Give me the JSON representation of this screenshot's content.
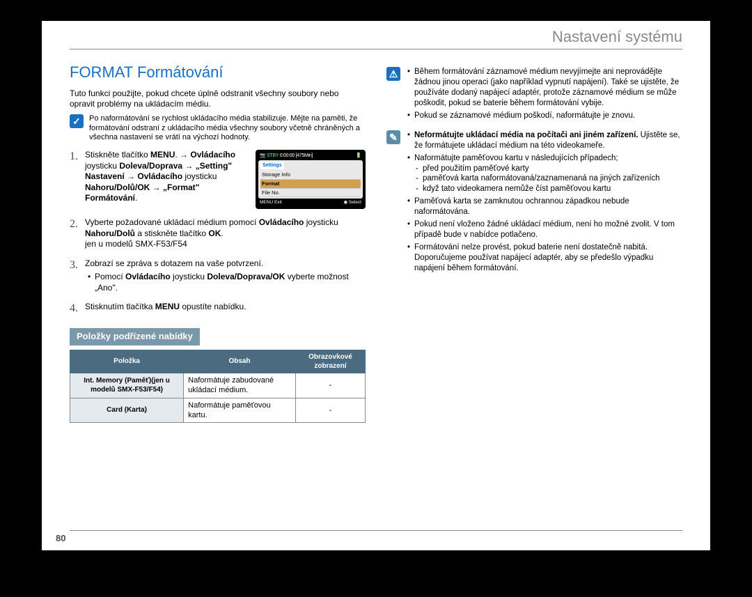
{
  "header": {
    "title": "Nastavení systému"
  },
  "page_number": "80",
  "left": {
    "section_title": "FORMAT Formátování",
    "intro": "Tuto funkci použijte, pokud chcete úplně odstranit všechny soubory nebo opravit problémy na ukládacím médiu.",
    "note1": "Po naformátování se rychlost ukládacího média stabilizuje. Mějte na paměti, že formátování odstraní z ukládacího média všechny soubory včetně chráněných a všechna nastavení se vrátí na výchozí hodnoty.",
    "steps": [
      {
        "pre": "Stiskněte tlačítko ",
        "bold1": "MENU",
        "mid1": ". → ",
        "bold2": "Ovládacího",
        "mid2": " joysticku ",
        "bold3": "Doleva/Doprava",
        "mid3": " → ",
        "bold4": "„Setting\" Nastavení",
        "mid4": " → ",
        "bold5": "Ovládacího",
        "mid5": " joysticku ",
        "bold6": "Nahoru/Dolů/OK",
        "mid6": " → ",
        "bold7": "„Format\" Formátování",
        "post": "."
      },
      {
        "pre": "Vyberte požadované ukládací médium pomocí ",
        "bold1": "Ovládacího",
        "mid1": " joysticku ",
        "bold2": "Nahoru/Dolů",
        "mid2": " a stiskněte tlačítko ",
        "bold3": "OK",
        "post": ".\njen u modelů SMX-F53/F54"
      },
      {
        "pre": "Zobrazí se zpráva s dotazem na vaše potvrzení.",
        "sub_pre": "Pomocí ",
        "sub_b1": "Ovládacího",
        "sub_mid1": " joysticku ",
        "sub_b2": "Doleva/Doprava/OK",
        "sub_post": " vyberte možnost „Ano\"."
      },
      {
        "pre": "Stisknutím tlačítka ",
        "bold1": "MENU",
        "post": " opustíte nabídku."
      }
    ],
    "lcd": {
      "stby": "STBY",
      "time": "0:00:00",
      "remain": "[475Min]",
      "tab": "Settings",
      "rows": [
        "Storage Info",
        "Format",
        "File No."
      ],
      "menu": "MENU",
      "exit": "Exit",
      "select": "Select"
    },
    "sub_heading": "Položky podřízené nabídky",
    "table": {
      "headers": [
        "Položka",
        "Obsah",
        "Obrazovkové zobrazení"
      ],
      "rows": [
        {
          "item": "Int. Memory (Paměť)(jen u modelů SMX-F53/F54)",
          "desc": "Naformátuje zabudované ukládací médium.",
          "disp": "-"
        },
        {
          "item": "Card (Karta)",
          "desc": "Naformátuje paměťovou kartu.",
          "disp": "-"
        }
      ]
    }
  },
  "right": {
    "warn": [
      "Během formátování záznamové médium nevyjímejte ani neprovádějte žádnou jinou operaci (jako například vypnutí napájení). Také se ujistěte, že používáte dodaný napájecí adaptér, protože záznamové médium se může poškodit, pokud se baterie během formátování vybije.",
      "Pokud se záznamové médium poškodí, naformátujte je znovu."
    ],
    "info_bold": "Neformátujte ukládací média na počítači ani jiném zařízení.",
    "info_after": "Ujistěte se, že formátujete ukládací médium na této videokameře.",
    "info": [
      "Naformátujte paměťovou kartu v následujících případech;",
      "Paměťová karta se zamknutou ochrannou západkou nebude naformátována.",
      "Pokud není vloženo žádné ukládací médium, není ho možné zvolit. V tom případě bude v nabídce potlačeno.",
      "Formátování nelze provést, pokud baterie není dostatečně nabitá. Doporučujeme používat napájecí adaptér, aby se předešlo výpadku napájení během formátování."
    ],
    "info_sub": [
      "před použitím paměťové karty",
      "paměťová karta naformátovaná/zaznamenaná na jiných zařízeních",
      "když tato videokamera nemůže číst paměťovou kartu"
    ]
  }
}
